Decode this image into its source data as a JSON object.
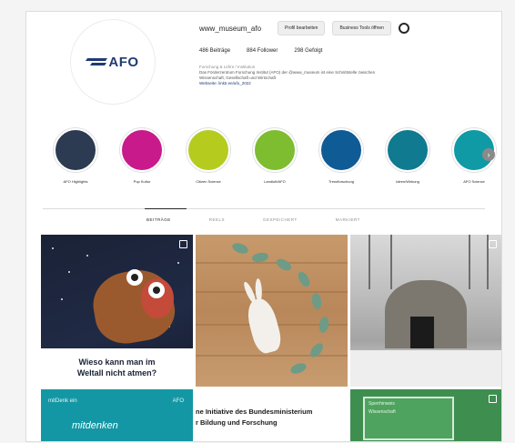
{
  "profile": {
    "username": "www_museum_afo",
    "edit_profile_label": "Profil bearbeiten",
    "ad_tools_label": "Business Tools öffnen",
    "stats": {
      "posts": "486 Beiträge",
      "followers": "884 Follower",
      "following": "298 Gefolgt"
    },
    "bio_category": "Forschung & Lehre / Institution",
    "bio_line1": "Das Förderzentrum Forschung Institut (AFO) der @www_museum ist eine Schnittstelle zwischen",
    "bio_line2": "Wissenschaft, Gesellschaft und Wirtschaft",
    "bio_link": "Webseite: linktr.ee/afo_2022",
    "logo_text": "AFO"
  },
  "highlights": [
    {
      "label": "AFO Highlights",
      "color": "#2c3a52"
    },
    {
      "label": "Pop Kultur",
      "color": "#c81a8a"
    },
    {
      "label": "Citizen Science",
      "color": "#b5cc1f"
    },
    {
      "label": "Landluft/AFO",
      "color": "#7dbd2f"
    },
    {
      "label": "Trendforschung",
      "color": "#0f5b95"
    },
    {
      "label": "Ideen/Wirkung",
      "color": "#107a90"
    },
    {
      "label": "AFO Science",
      "color": "#0f9aa6"
    }
  ],
  "tabs": [
    {
      "label": "BEITRÄGE",
      "active": true
    },
    {
      "label": "REELS",
      "active": false
    },
    {
      "label": "GESPEICHERT",
      "active": false
    },
    {
      "label": "MARKIERT",
      "active": false
    }
  ],
  "posts": {
    "post1_caption_line1": "Wieso kann man im",
    "post1_caption_line2": "Weltall nicht atmen?",
    "post4_brand": "mitDenk ein",
    "post4_big": "mitdenken",
    "post4_logo": "AFO",
    "post5_line1": "ne Initiative des Bundesministerium",
    "post5_line2": "r Bildung und Forschung",
    "post6_sign_line1": "Sperrhinweis",
    "post6_sign_line2": "Wissenschaft"
  },
  "next_arrow": "›"
}
